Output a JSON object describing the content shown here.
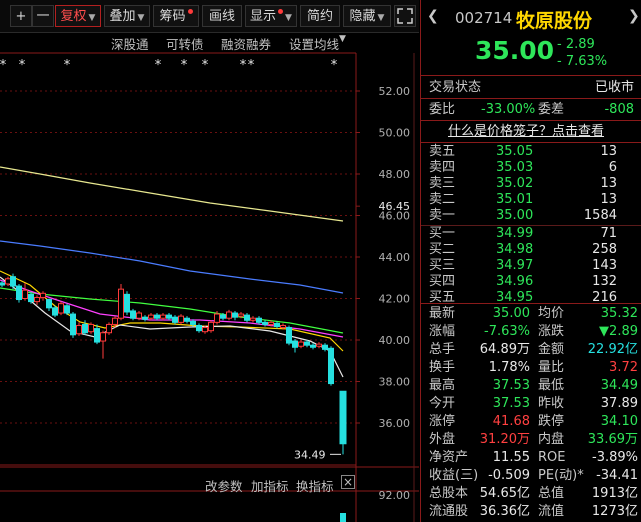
{
  "toolbar": {
    "plus": "+",
    "minus": "一",
    "fuquan": "复权",
    "diejia": "叠加",
    "chouma": "筹码",
    "huaxian": "画线",
    "xianshi": "显示",
    "jianyue": "简约",
    "yincang": "隐藏"
  },
  "chart": {
    "top_links": [
      "深股通",
      "可转债",
      "融资融券",
      "设置均线"
    ],
    "price_ticks": [
      "52.00",
      "50.00",
      "48.00",
      "46.45",
      "46.00",
      "44.00",
      "42.00",
      "40.00",
      "38.00",
      "36.00"
    ],
    "last_label": "34.49",
    "sub_tick": "92.00",
    "sub_buttons": [
      "改参数",
      "加指标",
      "换指标"
    ],
    "close_glyph": "×",
    "star_glyph": "*",
    "colors": {
      "up": "#ff3b3b",
      "down": "#26e0e0",
      "ma5": "#e8e8e8",
      "ma10": "#ffd700",
      "ma20": "#ff40ff",
      "ma60": "#40ff40",
      "ma120": "#4a7cff",
      "ma250": "#e8e890"
    }
  },
  "quote": {
    "code": "002714",
    "name": "牧原股份",
    "price": "35.00",
    "change": "- 2.89",
    "change_pct": "- 7.63%",
    "status_label": "交易状态",
    "status_value": "已收市",
    "weibi_label": "委比",
    "weibi_value": "-33.00%",
    "weicha_label": "委差",
    "weicha_value": "-808",
    "cage_link": "什么是价格笼子？点击查看"
  },
  "orderbook": {
    "sells": [
      {
        "label": "卖五",
        "price": "35.05",
        "vol": "13"
      },
      {
        "label": "卖四",
        "price": "35.03",
        "vol": "6"
      },
      {
        "label": "卖三",
        "price": "35.02",
        "vol": "13"
      },
      {
        "label": "卖二",
        "price": "35.01",
        "vol": "13"
      },
      {
        "label": "卖一",
        "price": "35.00",
        "vol": "1584"
      }
    ],
    "buys": [
      {
        "label": "买一",
        "price": "34.99",
        "vol": "71"
      },
      {
        "label": "买二",
        "price": "34.98",
        "vol": "258"
      },
      {
        "label": "买三",
        "price": "34.97",
        "vol": "143"
      },
      {
        "label": "买四",
        "price": "34.96",
        "vol": "132"
      },
      {
        "label": "买五",
        "price": "34.95",
        "vol": "216"
      }
    ]
  },
  "stats": [
    {
      "l1": "最新",
      "v1": "35.00",
      "c1": "g",
      "l2": "均价",
      "v2": "35.32",
      "c2": "g"
    },
    {
      "l1": "涨幅",
      "v1": "-7.63%",
      "c1": "g",
      "l2": "涨跌",
      "v2": "▼2.89",
      "c2": "g"
    },
    {
      "l1": "总手",
      "v1": "64.89万",
      "c1": "w",
      "l2": "金额",
      "v2": "22.92亿",
      "c2": "c"
    },
    {
      "l1": "换手",
      "v1": "1.78%",
      "c1": "w",
      "l2": "量比",
      "v2": "3.72",
      "c2": "r"
    },
    {
      "l1": "最高",
      "v1": "37.53",
      "c1": "g",
      "l2": "最低",
      "v2": "34.49",
      "c2": "g"
    },
    {
      "l1": "今开",
      "v1": "37.53",
      "c1": "g",
      "l2": "昨收",
      "v2": "37.89",
      "c2": "w"
    },
    {
      "l1": "涨停",
      "v1": "41.68",
      "c1": "r",
      "l2": "跌停",
      "v2": "34.10",
      "c2": "g"
    },
    {
      "l1": "外盘",
      "v1": "31.20万",
      "c1": "r",
      "l2": "内盘",
      "v2": "33.69万",
      "c2": "g"
    },
    {
      "l1": "净资产",
      "v1": "11.55",
      "c1": "w",
      "l2": "ROE",
      "v2": "-3.89%",
      "c2": "w"
    },
    {
      "l1": "收益(三)",
      "v1": "-0.509",
      "c1": "w",
      "l2": "PE(动)*",
      "v2": "-34.41",
      "c2": "w"
    },
    {
      "l1": "总股本",
      "v1": "54.65亿",
      "c1": "w",
      "l2": "总值",
      "v2": "1913亿",
      "c2": "w"
    },
    {
      "l1": "流通股",
      "v1": "36.36亿",
      "c1": "w",
      "l2": "流值",
      "v2": "1273亿",
      "c2": "w"
    }
  ]
}
